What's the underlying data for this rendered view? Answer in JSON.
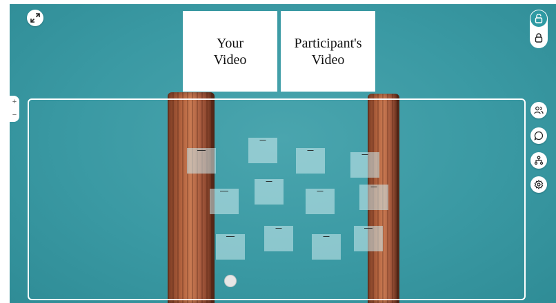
{
  "video": {
    "your_label": "Your\nVideo",
    "participant_label": "Participant's\nVideo"
  },
  "controls": {
    "fullscreen_icon": "expand-arrows-icon",
    "lock_unlocked_icon": "unlock-icon",
    "lock_locked_icon": "lock-icon",
    "zoom_in": "+",
    "zoom_out": "−",
    "participants_icon": "users-icon",
    "chat_icon": "chat-bubble-icon",
    "tree_icon": "hierarchy-icon",
    "settings_icon": "gear-icon"
  },
  "colors": {
    "accent": "#2e9aa3",
    "background": "#3a99a3"
  }
}
